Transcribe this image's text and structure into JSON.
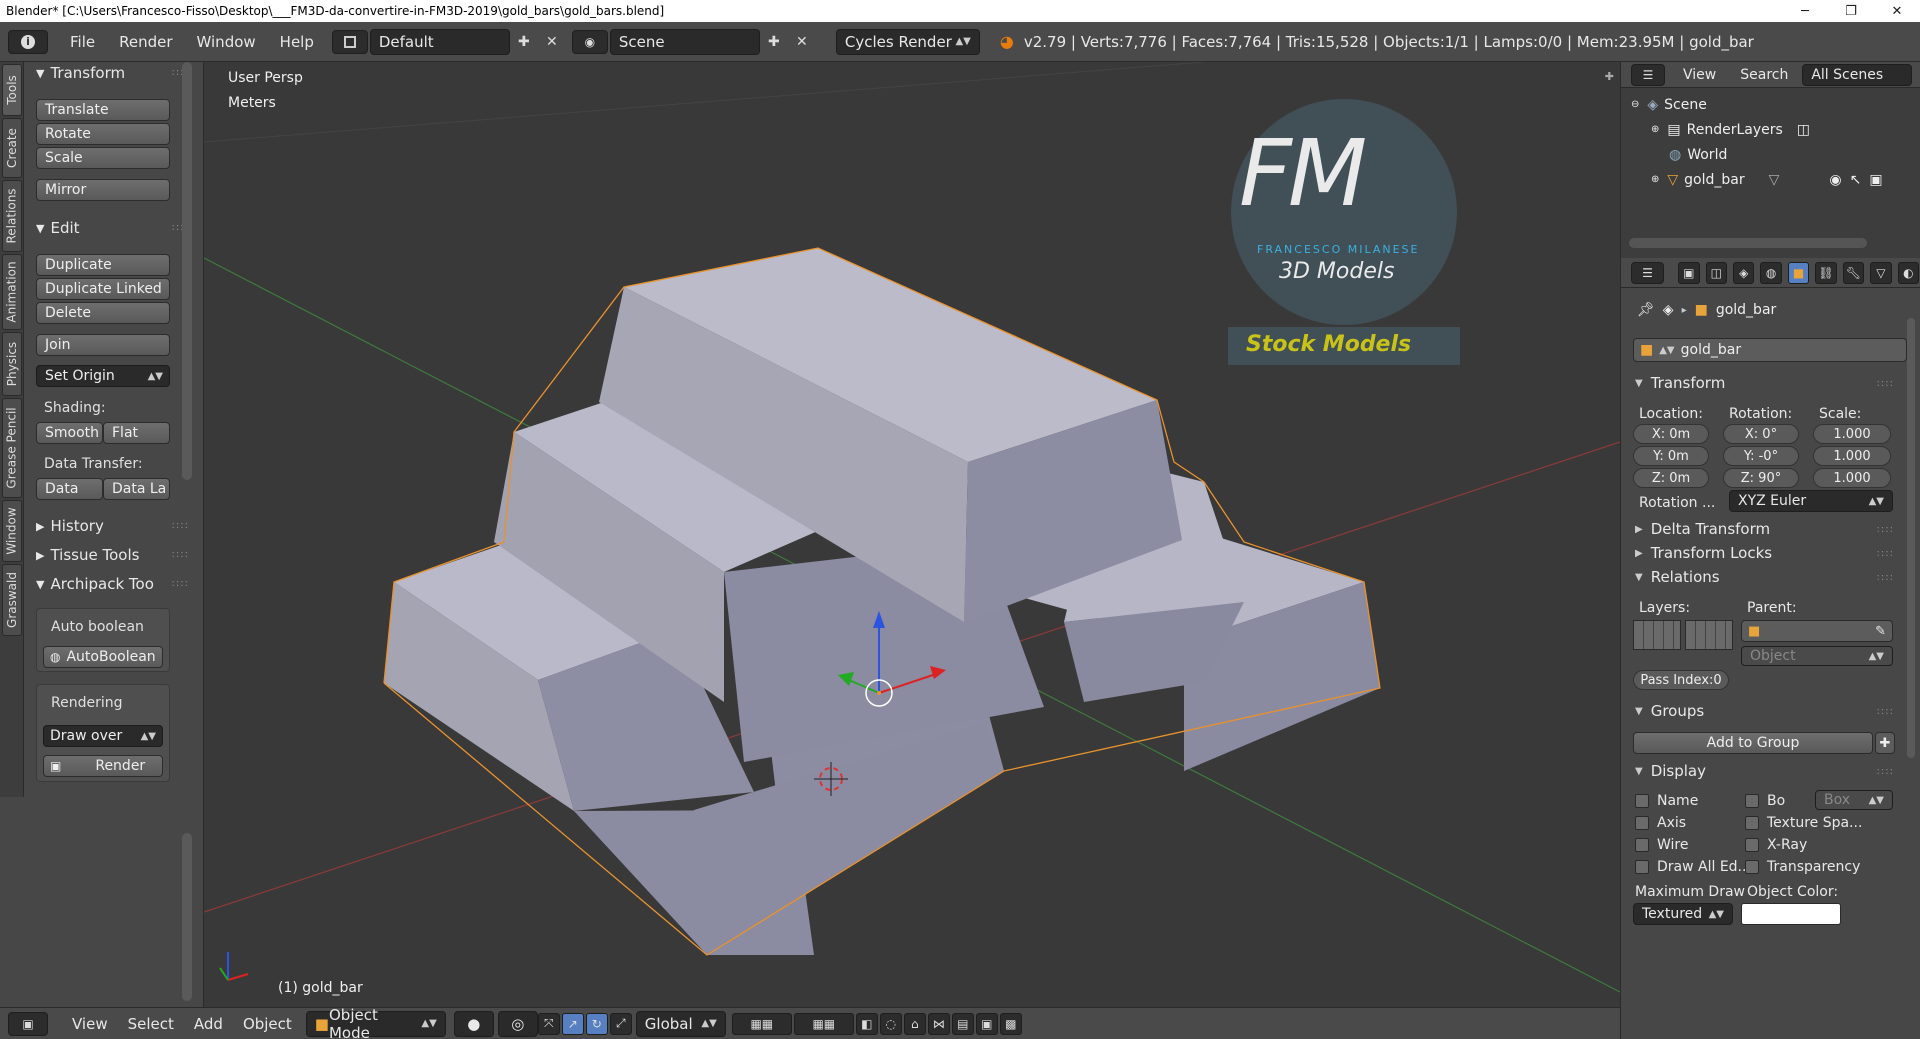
{
  "window": {
    "title": "Blender* [C:\\Users\\Francesco-Fisso\\Desktop\\___FM3D-da-convertire-in-FM3D-2019\\gold_bars\\gold_bars.blend]",
    "minimize": "─",
    "maximize": "❐",
    "close": "✕"
  },
  "info_header": {
    "menus": [
      "File",
      "Render",
      "Window",
      "Help"
    ],
    "screen_layout": "Default",
    "scene": "Scene",
    "engine": "Cycles Render",
    "stats": "v2.79 | Verts:7,776 | Faces:7,764 | Tris:15,528 | Objects:1/1 | Lamps:0/0 | Mem:23.95M | gold_bar"
  },
  "tool_tabs": [
    "Tools",
    "Create",
    "Relations",
    "Animation",
    "Physics",
    "Grease Pencil",
    "Window",
    "Graswald"
  ],
  "toolshelf": {
    "transform": {
      "title": "Transform",
      "buttons": [
        "Translate",
        "Rotate",
        "Scale",
        "Mirror"
      ]
    },
    "edit": {
      "title": "Edit",
      "buttons": [
        "Duplicate",
        "Duplicate Linked",
        "Delete",
        "Join"
      ],
      "set_origin": "Set Origin"
    },
    "shading": {
      "label": "Shading:",
      "smooth": "Smooth",
      "flat": "Flat"
    },
    "data_transfer": {
      "label": "Data Transfer:",
      "data": "Data",
      "data_layers": "Data La"
    },
    "history": "History",
    "tissue": "Tissue Tools",
    "archipack": {
      "title": "Archipack Too",
      "auto_boolean_label": "Auto boolean",
      "auto_boolean_btn": "AutoBoolean",
      "rendering_label": "Rendering",
      "draw_over": "Draw over",
      "render_btn": "Render"
    }
  },
  "viewport": {
    "view_name": "User Persp",
    "units": "Meters",
    "object_label": "(1) gold_bar",
    "logo": {
      "fm": "FM",
      "name": "FRANCESCO MILANESE",
      "sub": "3D Models",
      "stock": "Stock Models"
    }
  },
  "view3d_header": {
    "menus": [
      "View",
      "Select",
      "Add",
      "Object"
    ],
    "mode": "Object Mode",
    "orientation": "Global"
  },
  "outliner": {
    "menus": [
      "View",
      "Search"
    ],
    "filter": "All Scenes",
    "items": [
      "Scene",
      "RenderLayers",
      "World",
      "gold_bar"
    ]
  },
  "properties": {
    "breadcrumb": "gold_bar",
    "object_name": "gold_bar",
    "transform": {
      "title": "Transform",
      "location_label": "Location:",
      "rotation_label": "Rotation:",
      "scale_label": "Scale:",
      "location": [
        "X: 0m",
        "Y: 0m",
        "Z: 0m"
      ],
      "rotation": [
        "X: 0°",
        "Y: -0°",
        "Z: 90°"
      ],
      "scale": [
        "1.000",
        "1.000",
        "1.000"
      ],
      "rotation_mode_label": "Rotation ...",
      "rotation_mode": "XYZ Euler"
    },
    "delta_transform": "Delta Transform",
    "transform_locks": "Transform Locks",
    "relations": {
      "title": "Relations",
      "layers_label": "Layers:",
      "parent_label": "Parent:",
      "parent_type": "Object",
      "pass_index": "Pass Index:0"
    },
    "groups": {
      "title": "Groups",
      "add_btn": "Add to Group"
    },
    "display": {
      "title": "Display",
      "left": [
        "Name",
        "Axis",
        "Wire",
        "Draw All Ed..."
      ],
      "right": [
        "Bo",
        "Texture Spa...",
        "X-Ray",
        "Transparency"
      ],
      "bounds_type": "Box",
      "max_draw_label": "Maximum Draw",
      "max_draw": "Textured",
      "object_color_label": "Object Color:"
    }
  },
  "colors": {
    "accent": "#5680c2",
    "selection_outline": "#e8922e",
    "bar_face": "#a6a6b8"
  }
}
